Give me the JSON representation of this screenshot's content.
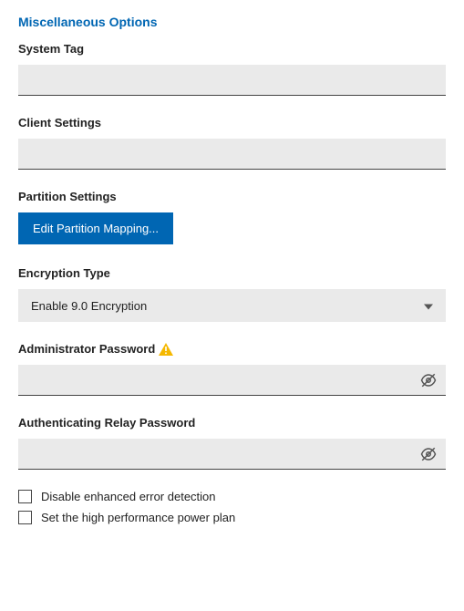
{
  "section_title": "Miscellaneous Options",
  "system_tag": {
    "label": "System Tag",
    "value": ""
  },
  "client_settings": {
    "label": "Client Settings",
    "value": ""
  },
  "partition_settings": {
    "label": "Partition Settings",
    "button_label": "Edit Partition Mapping..."
  },
  "encryption_type": {
    "label": "Encryption Type",
    "selected": "Enable 9.0 Encryption"
  },
  "admin_password": {
    "label": "Administrator Password",
    "value": ""
  },
  "relay_password": {
    "label": "Authenticating Relay Password",
    "value": ""
  },
  "checkboxes": {
    "disable_error_detection": {
      "label": "Disable enhanced error detection",
      "checked": false
    },
    "high_perf_power_plan": {
      "label": "Set the high performance power plan",
      "checked": false
    }
  }
}
